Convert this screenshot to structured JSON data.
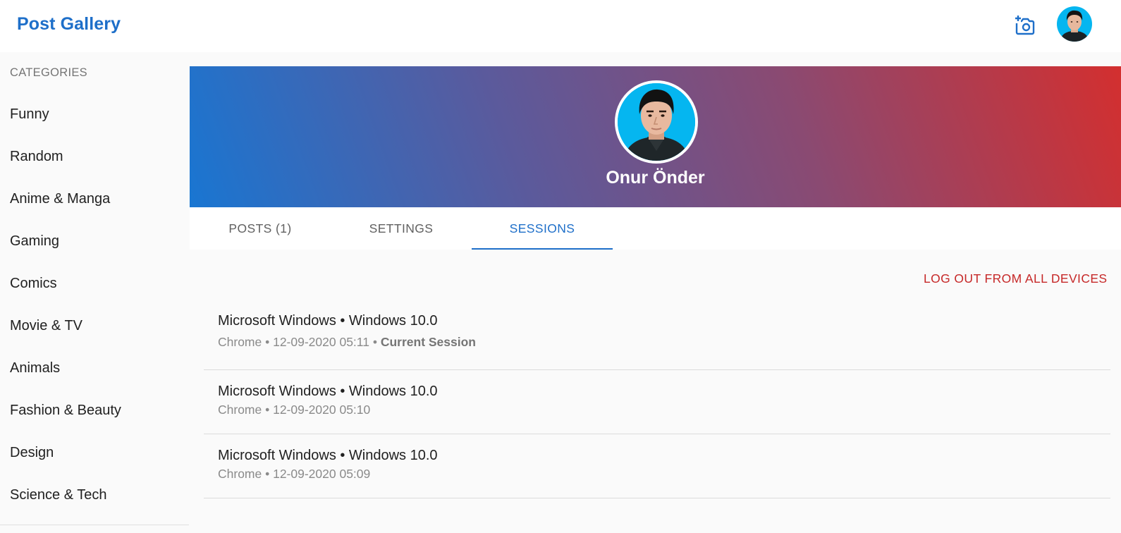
{
  "app": {
    "title": "Post Gallery",
    "icons": {
      "add_photo": "add-photo-icon",
      "avatar": "user-avatar"
    }
  },
  "sidebar": {
    "header": "CATEGORIES",
    "items": [
      {
        "label": "Funny"
      },
      {
        "label": "Random"
      },
      {
        "label": "Anime & Manga"
      },
      {
        "label": "Gaming"
      },
      {
        "label": "Comics"
      },
      {
        "label": "Movie & TV"
      },
      {
        "label": "Animals"
      },
      {
        "label": "Fashion & Beauty"
      },
      {
        "label": "Design"
      },
      {
        "label": "Science & Tech"
      }
    ]
  },
  "profile": {
    "name": "Onur Önder",
    "banner_gradient": [
      "#1976d2",
      "#d32f2f"
    ]
  },
  "tabs": [
    {
      "label": "POSTS (1)"
    },
    {
      "label": "SETTINGS"
    },
    {
      "label": "SESSIONS"
    }
  ],
  "active_tab": "SESSIONS",
  "actions": {
    "logout_all": "LOG OUT FROM ALL DEVICES"
  },
  "sessions": [
    {
      "title": "Microsoft Windows • Windows 10.0",
      "detail": "Chrome • 12-09-2020 05:11",
      "separator": " • ",
      "current_label": "Current Session"
    },
    {
      "title": "Microsoft Windows • Windows 10.0",
      "detail": "Chrome • 12-09-2020 05:10"
    },
    {
      "title": "Microsoft Windows • Windows 10.0",
      "detail": "Chrome • 12-09-2020 05:09"
    }
  ],
  "colors": {
    "brand": "#1e6fc9",
    "danger": "#c62828",
    "avatar_bg": "#05b6f0"
  }
}
